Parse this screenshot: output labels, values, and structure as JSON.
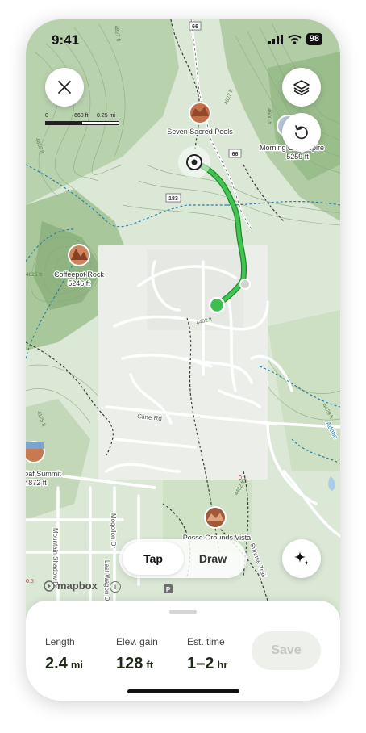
{
  "status_bar": {
    "time": "9:41",
    "battery": "98"
  },
  "map": {
    "scale": {
      "zero": "0",
      "feet": "660 ft",
      "miles": "0.25 mi"
    },
    "places": [
      {
        "name": "Seven Sacred Pools"
      },
      {
        "name": "Coffeepot Rock",
        "elevation": "5246 ft"
      },
      {
        "name": "Morning Glory Spire",
        "elevation": "5259 ft"
      },
      {
        "name": "Sugarloaf Summit",
        "elevation": "4872 ft"
      },
      {
        "name": "Posse Grounds Vista"
      }
    ],
    "road_labels": [
      "Cline Rd",
      "Sunrise Trail",
      "Adobe",
      "Last Wagon Dr",
      "Mogollon Dr",
      "Mountain Shadow Dr"
    ],
    "shields": [
      "66",
      "183",
      "66"
    ],
    "contour_labels": [
      "4827 ft",
      "4623 ft",
      "4402 ft",
      "4429 ft",
      "4462 ft",
      "4600 ft",
      "4125 ft",
      "4825 ft",
      "4850 ft"
    ],
    "attribution": "mapbox",
    "colors": {
      "route": "#2fb344",
      "route_outline": "#1d8a2c",
      "contour": "#7a9a6a",
      "trail": "#444444",
      "water_trail": "#2a7fa8"
    }
  },
  "controls": {
    "close": "close",
    "layers": "layers",
    "undo": "undo",
    "magic": "sparkle"
  },
  "mode_toggle": {
    "tap": "Tap",
    "draw": "Draw",
    "selected": "Tap"
  },
  "stats": {
    "length": {
      "label": "Length",
      "value": "2.4",
      "unit": "mi"
    },
    "elevation": {
      "label": "Elev. gain",
      "value": "128",
      "unit": "ft"
    },
    "time": {
      "label": "Est. time",
      "value": "1–2",
      "unit": "hr"
    }
  },
  "save_label": "Save"
}
